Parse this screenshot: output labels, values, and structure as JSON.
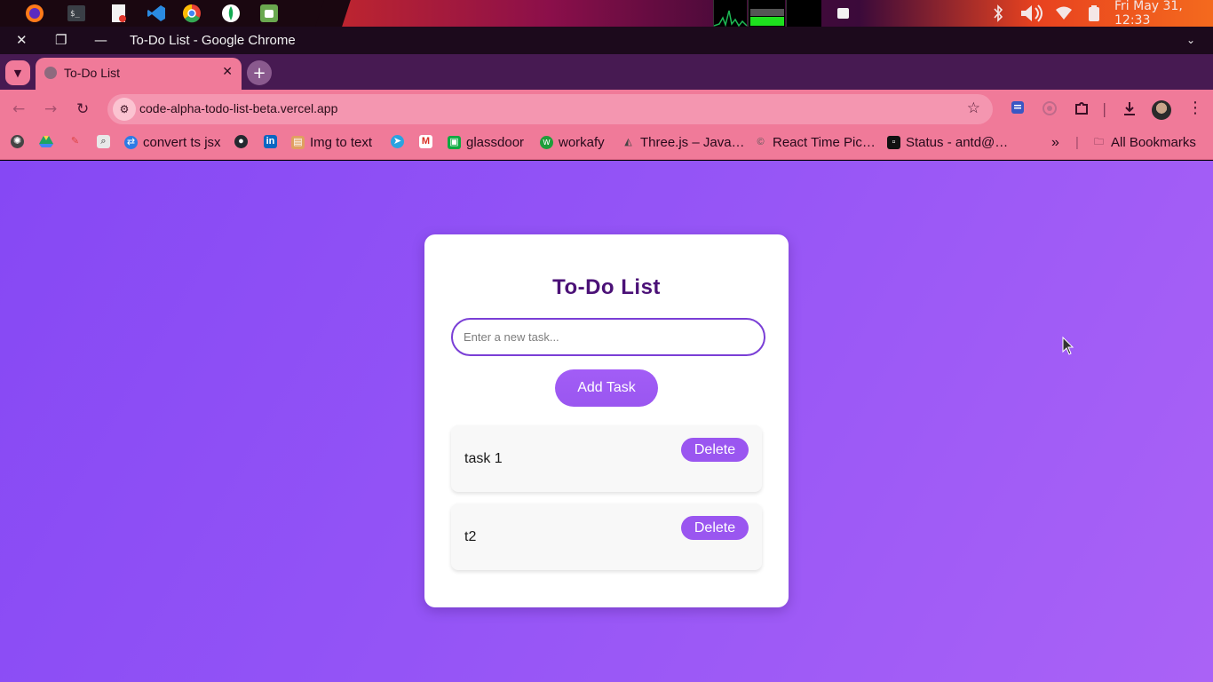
{
  "taskbar": {
    "apps": [
      "firefox-icon",
      "terminal-icon",
      "text-editor-icon",
      "vscode-icon",
      "chrome-icon",
      "mongodb-icon",
      "android-icon"
    ],
    "clock": "Fri May 31, 12:33",
    "monitor_text": ""
  },
  "window": {
    "title": "To-Do List - Google Chrome"
  },
  "tabs": [
    {
      "title": "To-Do List",
      "active": true
    }
  ],
  "toolbar": {
    "url": "code-alpha-todo-list-beta.vercel.app"
  },
  "bookmarks": {
    "items": [
      {
        "label": "convert ts jsx",
        "color": "#2d7be5"
      },
      {
        "label": "Img to text",
        "color": "#e0a060"
      },
      {
        "label": "glassdoor",
        "color": "#0caa41"
      },
      {
        "label": "workafy",
        "color": "#1e9e3a"
      },
      {
        "label": "Three.js – Java…",
        "color": "#555555"
      },
      {
        "label": "React Time Pic…",
        "color": "#555555"
      },
      {
        "label": "Status - antd@…",
        "color": "#111111"
      }
    ],
    "all_bookmarks": "All Bookmarks"
  },
  "app": {
    "heading": "To-Do List",
    "input_placeholder": "Enter a new task...",
    "add_button": "Add Task",
    "tasks": [
      {
        "text": "task 1",
        "delete_label": "Delete"
      },
      {
        "text": "t2",
        "delete_label": "Delete"
      }
    ]
  },
  "colors": {
    "accent": "#9a56f0",
    "heading": "#4b1177",
    "chrome_theme": "#f07a99"
  }
}
